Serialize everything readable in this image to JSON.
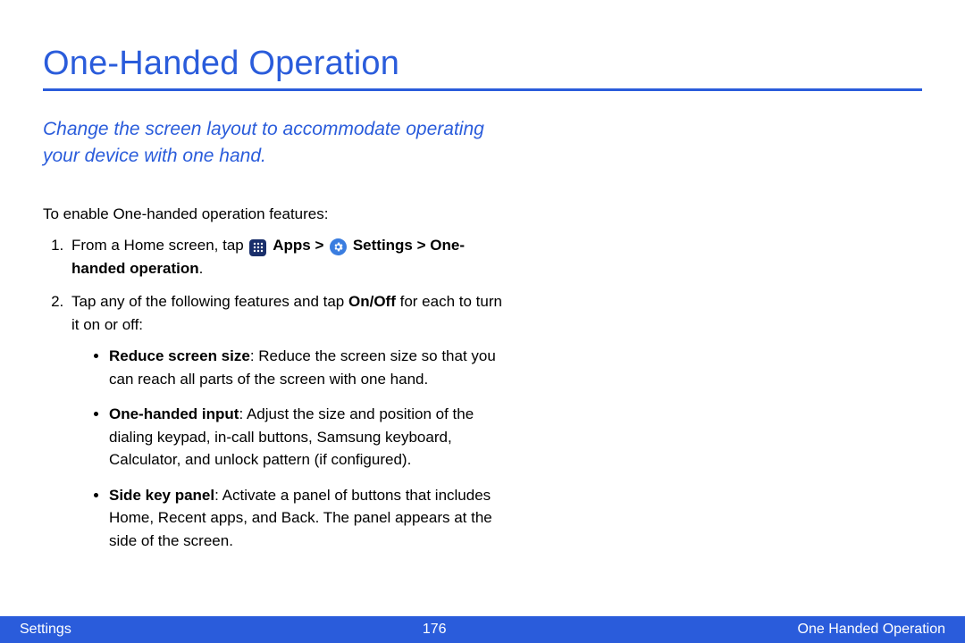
{
  "title": "One-Handed Operation",
  "subtitle": "Change the screen layout to accommodate operating your device with one hand.",
  "intro": "To enable One-handed operation features:",
  "step1": {
    "pre": "From a Home screen, tap ",
    "apps": "Apps",
    "sep1": " > ",
    "settings": "Settings",
    "sep2": " > ",
    "onehanded": "One-handed operation",
    "post": "."
  },
  "step2": {
    "pre": "Tap any of the following features and tap ",
    "onoff": "On/Off",
    "post": " for each to turn it on or off:"
  },
  "bullets": [
    {
      "term": "Reduce screen size",
      "desc": ": Reduce the screen size so that you can reach all parts of the screen with one hand."
    },
    {
      "term": "One-handed input",
      "desc": ": Adjust the size and position of the dialing keypad, in-call buttons, Samsung keyboard, Calculator, and unlock pattern (if configured)."
    },
    {
      "term": "Side key panel",
      "desc": ": Activate a panel of buttons that includes Home, Recent apps, and Back. The panel appears at the side of the screen."
    }
  ],
  "footer": {
    "left": "Settings",
    "center": "176",
    "right": "One Handed Operation"
  }
}
